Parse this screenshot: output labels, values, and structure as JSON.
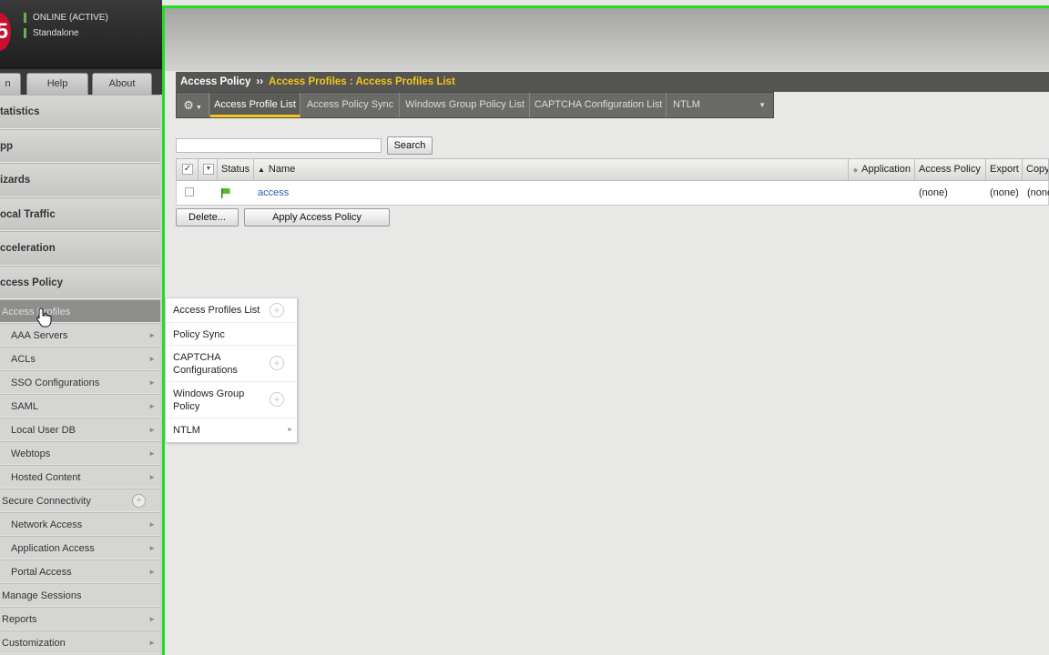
{
  "status": {
    "online": "ONLINE (ACTIVE)",
    "mode": "Standalone"
  },
  "left_tabs": [
    {
      "label": "n"
    },
    {
      "label": "Help"
    },
    {
      "label": "About"
    }
  ],
  "nav": {
    "majors": [
      {
        "label": "tatistics"
      },
      {
        "label": "pp"
      },
      {
        "label": "izards"
      },
      {
        "label": "ocal Traffic"
      },
      {
        "label": "cceleration"
      },
      {
        "label": "ccess Policy"
      }
    ],
    "subs": [
      {
        "label": "Access Profiles"
      },
      {
        "label": "AAA Servers"
      },
      {
        "label": "ACLs"
      },
      {
        "label": "SSO Configurations"
      },
      {
        "label": "SAML"
      },
      {
        "label": "Local User DB"
      },
      {
        "label": "Webtops"
      },
      {
        "label": "Hosted Content"
      },
      {
        "label": "Secure Connectivity"
      },
      {
        "label": "Network Access"
      },
      {
        "label": "Application Access"
      },
      {
        "label": "Portal Access"
      },
      {
        "label": "Manage Sessions"
      },
      {
        "label": "Reports"
      },
      {
        "label": "Customization"
      }
    ]
  },
  "breadcrumb": {
    "root": "Access Policy",
    "separator": "››",
    "current": "Access Profiles : Access Profiles List"
  },
  "subtabs": [
    {
      "label": "Access Profile List"
    },
    {
      "label": "Access Policy Sync"
    },
    {
      "label": "Windows Group Policy List"
    },
    {
      "label": "CAPTCHA Configuration List"
    },
    {
      "label": "NTLM"
    }
  ],
  "search": {
    "value": "",
    "button": "Search"
  },
  "table": {
    "columns": {
      "status": "Status",
      "name": "Name",
      "application": "Application",
      "access_policy": "Access Policy",
      "export": "Export",
      "copy": "Copy"
    },
    "rows": [
      {
        "name": "access",
        "application": "",
        "access_policy": "(none)",
        "export": "(none)",
        "copy": "(none)"
      }
    ]
  },
  "actions": {
    "delete": "Delete...",
    "apply": "Apply Access Policy"
  },
  "flyout": [
    {
      "line1": "Access Profiles List",
      "line2": ""
    },
    {
      "line1": "Policy Sync",
      "line2": ""
    },
    {
      "line1": "CAPTCHA",
      "line2": "Configurations"
    },
    {
      "line1": "Windows Group",
      "line2": "Policy"
    },
    {
      "line1": "NTLM",
      "line2": ""
    }
  ],
  "colors": {
    "frame": "#22dd22",
    "accent": "#f5c518",
    "link": "#2a5db0",
    "brand": "#c8102e"
  }
}
